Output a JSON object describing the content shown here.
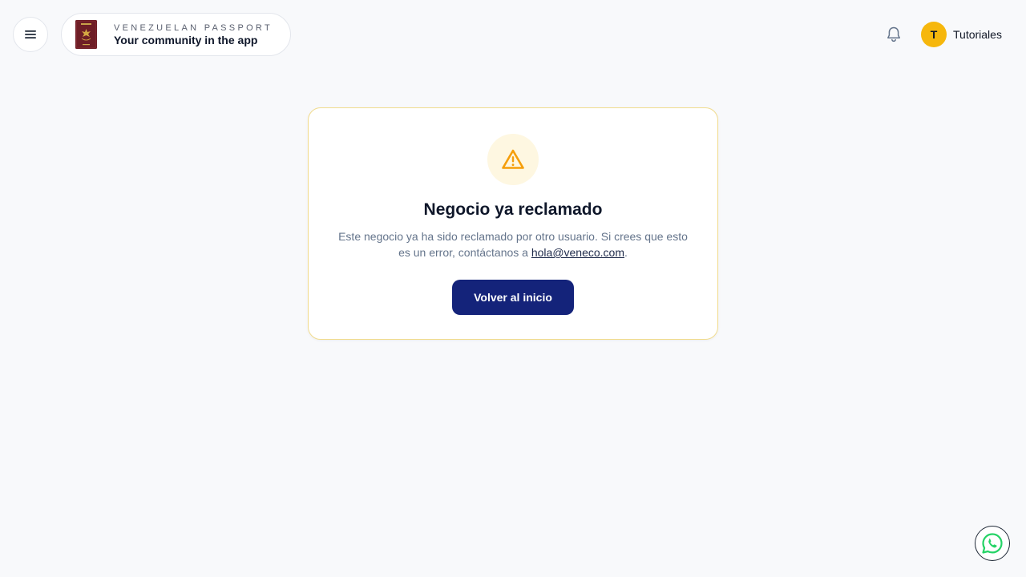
{
  "header": {
    "menu_icon": "hamburger-menu-icon",
    "brand": {
      "tagline": "VENEZUELAN PASSPORT",
      "title": "Your community in the app",
      "logo_icon": "passport-logo",
      "logo_color": "#6e1e26"
    },
    "notifications_icon": "bell-icon",
    "user": {
      "initial": "T",
      "name": "Tutoriales",
      "avatar_color": "#f6b70c"
    }
  },
  "card": {
    "icon": "warning-triangle-icon",
    "title": "Negocio ya reclamado",
    "message_before_link": "Este negocio ya ha sido reclamado por otro usuario. Si crees que esto es un error, contáctanos a",
    "email": "hola@veneco.com",
    "message_after_link": ".",
    "button_label": "Volver al inicio"
  },
  "floating": {
    "whatsapp_icon": "whatsapp-icon"
  },
  "colors": {
    "accent": "#14237a",
    "warning": "#f59e0b",
    "background": "#f8f9fb"
  }
}
